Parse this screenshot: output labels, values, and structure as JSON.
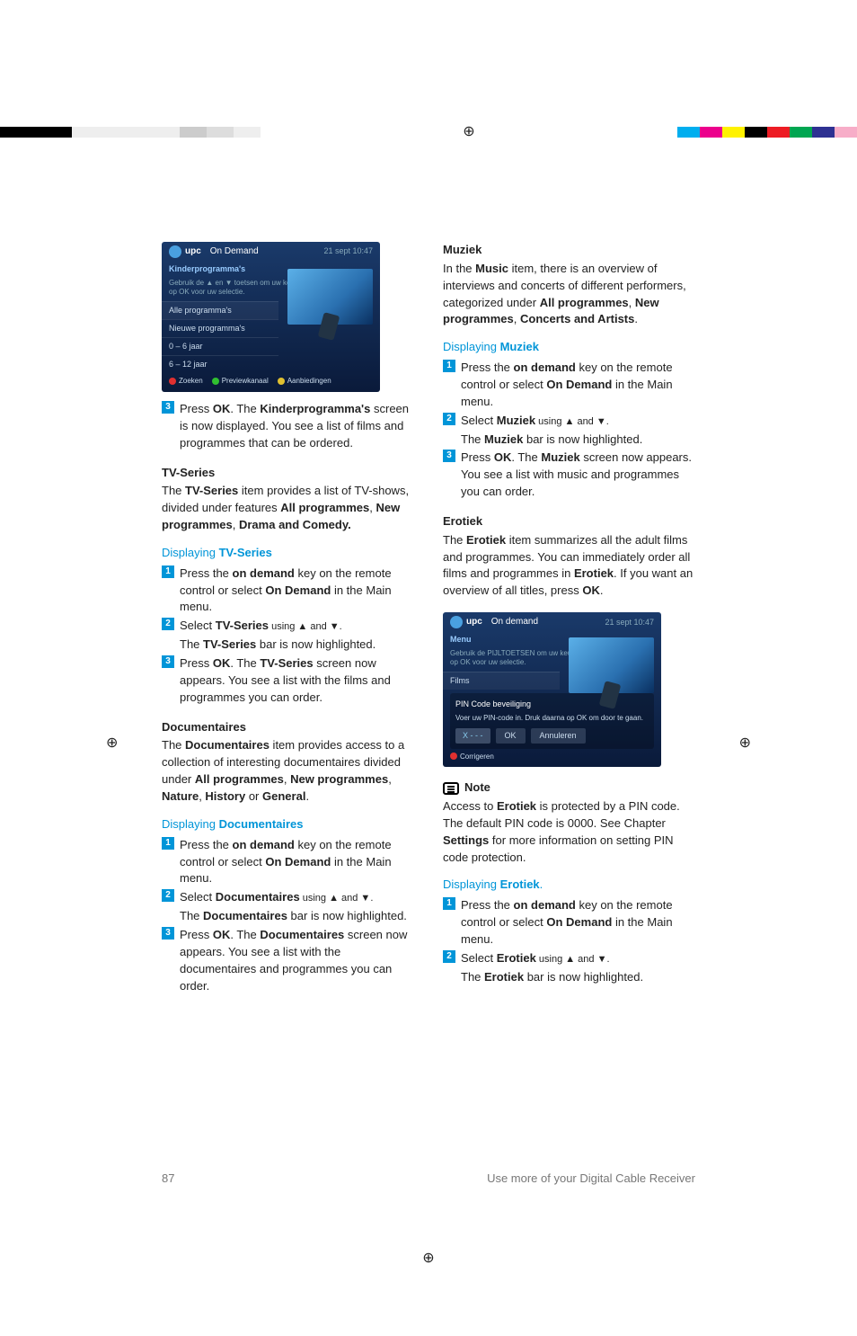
{
  "registration_mark": "⊕",
  "screenshot1": {
    "brand": "upc",
    "title": "On Demand",
    "time": "21 sept 10:47",
    "subtitle": "Kinderprogramma's",
    "help": "Gebruik de ▲ en ▼ toetsen om uw keuze te markeren en druk op OK voor uw selectie.",
    "rows": [
      "Alle programma's",
      "Nieuwe programma's",
      "0 – 6 jaar",
      "6 – 12 jaar"
    ],
    "foot": [
      "Zoeken",
      "Previewkanaal",
      "Aanbiedingen"
    ]
  },
  "col1": {
    "step3": {
      "num": "3",
      "a": "Press ",
      "b": "OK",
      "c": ". The ",
      "d": "Kinderprogramma's",
      "e": " screen is now displayed. You see a list of films and programmes that can be ordered."
    },
    "tvseries": {
      "h": "TV-Series",
      "p_a": "The ",
      "p_b": "TV-Series",
      "p_c": " item provides a list of TV-shows, divided under features ",
      "p_d": "All programmes",
      "p_e": ", ",
      "p_f": "New programmes",
      "p_g": ", ",
      "p_h": "Drama and Comedy."
    },
    "disp_tv": {
      "a": "Displaying ",
      "b": "TV-Series"
    },
    "tv1": {
      "num": "1",
      "a": "Press the ",
      "b": "on demand",
      "c": " key on the remote control or select ",
      "d": "On Demand",
      "e": " in the Main menu."
    },
    "tv2": {
      "num": "2",
      "a": "Select ",
      "b": "TV-Series",
      "c": " using ▲ and ▼.",
      "d": "The ",
      "e": "TV-Series",
      "f": " bar is now highlighted."
    },
    "tv3": {
      "num": "3",
      "a": "Press ",
      "b": "OK",
      "c": ". The ",
      "d": "TV-Series",
      "e": " screen now appears. You see a list with the films and programmes you can order."
    },
    "docs": {
      "h": "Documentaires",
      "p_a": "The ",
      "p_b": "Documentaires",
      "p_c": " item provides access to a collection of interesting documentaires divided under ",
      "p_d": "All programmes",
      "p_e": ", ",
      "p_f": "New programmes",
      "p_g": ", ",
      "p_h": "Nature",
      "p_i": ", ",
      "p_j": "History",
      "p_k": " or ",
      "p_l": "General",
      "p_m": "."
    },
    "disp_doc": {
      "a": "Displaying ",
      "b": "Documentaires"
    },
    "doc1": {
      "num": "1",
      "a": "Press the ",
      "b": "on demand",
      "c": " key on the remote control or select ",
      "d": "On Demand",
      "e": " in the Main menu."
    },
    "doc2": {
      "num": "2",
      "a": "Select ",
      "b": "Documentaires",
      "c": " using ▲ and ▼.",
      "d": "The ",
      "e": "Documentaires",
      "f": " bar is now highlighted."
    },
    "doc3": {
      "num": "3",
      "a": "Press ",
      "b": "OK",
      "c": ". The ",
      "d": "Documentaires",
      "e": " screen now appears. You see a list with the documentaires and programmes you can order."
    }
  },
  "col2": {
    "muziek": {
      "h": "Muziek",
      "p_a": "In the ",
      "p_b": "Music",
      "p_c": " item, there is an overview of interviews and concerts of different performers, categorized under ",
      "p_d": "All programmes",
      "p_e": ", ",
      "p_f": "New programmes",
      "p_g": ", ",
      "p_h": "Concerts and Artists",
      "p_i": "."
    },
    "disp_mz": {
      "a": "Displaying ",
      "b": "Muziek"
    },
    "mz1": {
      "num": "1",
      "a": "Press the ",
      "b": "on demand",
      "c": " key on the remote control or select ",
      "d": "On Demand",
      "e": " in the Main menu."
    },
    "mz2": {
      "num": "2",
      "a": "Select ",
      "b": "Muziek",
      "c": " using ▲ and ▼.",
      "d": "The ",
      "e": "Muziek",
      "f": " bar is now highlighted."
    },
    "mz3": {
      "num": "3",
      "a": "Press ",
      "b": "OK",
      "c": ". The ",
      "d": "Muziek",
      "e": " screen now appears. You see a list with music and programmes you can order."
    },
    "erotiek": {
      "h": "Erotiek",
      "p_a": "The ",
      "p_b": "Erotiek",
      "p_c": " item summarizes all the adult films and programmes. You can immediately order all films and programmes in ",
      "p_d": "Erotiek",
      "p_e": ". If you want an overview of all titles, press ",
      "p_f": "OK",
      "p_g": "."
    },
    "note_h": "Note",
    "note": {
      "a": "Access to ",
      "b": "Erotiek",
      "c": " is protected by a PIN code. The default PIN code is 0000. See Chapter ",
      "d": "Settings",
      "e": " for more information on setting PIN code protection."
    },
    "disp_er": {
      "a": "Displaying ",
      "b": "Erotiek",
      "c": "."
    },
    "er1": {
      "num": "1",
      "a": "Press the ",
      "b": "on demand",
      "c": " key on the remote control or select ",
      "d": "On Demand",
      "e": " in the Main menu."
    },
    "er2": {
      "num": "2",
      "a": "Select ",
      "b": "Erotiek",
      "c": " using ▲ and ▼.",
      "d": "The ",
      "e": "Erotiek",
      "f": " bar is now highlighted."
    }
  },
  "screenshot2": {
    "brand": "upc",
    "title": "On demand",
    "time": "21 sept 10:47",
    "menu": "Menu",
    "help": "Gebruik de PIJLTOETSEN om uw keuze te markeren en druk op OK voor uw selectie.",
    "row": "Films",
    "pin_title": "PIN Code beveiliging",
    "pin_help": "Voer uw PIN-code in. Druk daarna op OK om door te gaan.",
    "field": "X - - -",
    "ok": "OK",
    "cancel": "Annuleren",
    "foot": "Corrigeren"
  },
  "foot": {
    "page": "87",
    "section": "Use more of your Digital Cable Receiver"
  }
}
